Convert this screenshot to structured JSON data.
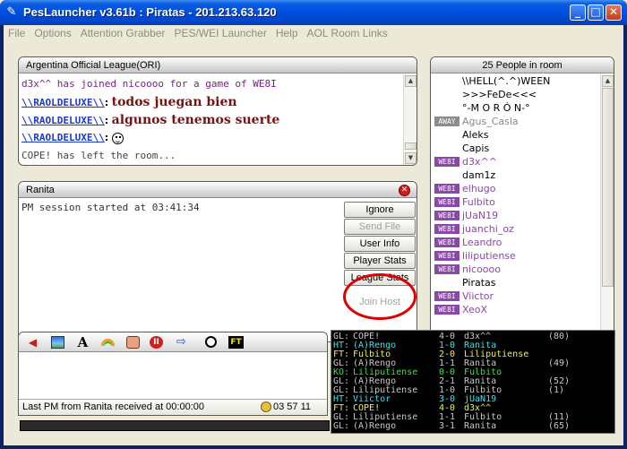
{
  "window": {
    "title": "PesLauncher v3.61b : Piratas - 201.213.63.120",
    "minimize": "_",
    "maximize": "□",
    "close": "✕"
  },
  "menu": [
    "File",
    "Options",
    "Attention Grabber",
    "PES/WEI Launcher",
    "Help",
    "AOL Room Links"
  ],
  "chat": {
    "title": "Argentina Official League(ORI)",
    "lines": [
      {
        "kind": "sys",
        "text": "d3x^^ has joined nicoooo for a game of WE8I"
      },
      {
        "kind": "msg",
        "nick": "\\\\RAOLDELUXE\\\\",
        "text": "todos juegan bien"
      },
      {
        "kind": "msg",
        "nick": "\\\\RAOLDELUXE\\\\",
        "text": "algunos tenemos suerte"
      },
      {
        "kind": "msg",
        "nick": "\\\\RAOLDELUXE\\\\",
        "text": ""
      },
      {
        "kind": "sys-gray",
        "text": "COPE! has left the room..."
      }
    ],
    "colon": ":"
  },
  "pm": {
    "title": "Ranita",
    "message": "PM session started at 03:41:34",
    "buttons": [
      {
        "label": "Ignore",
        "enabled": true
      },
      {
        "label": "Send File",
        "enabled": false
      },
      {
        "label": "User Info",
        "enabled": true
      },
      {
        "label": "Player Stats",
        "enabled": true
      },
      {
        "label": "League Stats",
        "enabled": true
      },
      {
        "label": "Join Host",
        "enabled": false
      }
    ]
  },
  "users": {
    "title": "25 People in room",
    "list": [
      {
        "badge": "",
        "name": "\\\\HELL(^.^)WEEN",
        "style": "normal"
      },
      {
        "badge": "",
        "name": ">>>FeDe<<<",
        "style": "normal"
      },
      {
        "badge": "",
        "name": "°-M O R Ó N-°",
        "style": "normal"
      },
      {
        "badge": "AWAY",
        "name": "Agus_Casla",
        "style": "gray"
      },
      {
        "badge": "",
        "name": "Aleks",
        "style": "normal"
      },
      {
        "badge": "",
        "name": "Capis",
        "style": "normal"
      },
      {
        "badge": "WE8I",
        "name": "d3x^^",
        "style": "we"
      },
      {
        "badge": "",
        "name": "dam1z",
        "style": "normal"
      },
      {
        "badge": "WE8I",
        "name": "elhugo",
        "style": "we"
      },
      {
        "badge": "WE8I",
        "name": "Fulbito",
        "style": "we"
      },
      {
        "badge": "WE8I",
        "name": "jUaN19",
        "style": "we"
      },
      {
        "badge": "WE8I",
        "name": "juanchi_oz",
        "style": "we"
      },
      {
        "badge": "WE8I",
        "name": "Leandro",
        "style": "we"
      },
      {
        "badge": "WE8I",
        "name": "liliputiense",
        "style": "we"
      },
      {
        "badge": "WE8I",
        "name": "nicoooo",
        "style": "we"
      },
      {
        "badge": "",
        "name": "Piratas",
        "style": "normal"
      },
      {
        "badge": "WE8I",
        "name": "Viictor",
        "style": "we"
      },
      {
        "badge": "WE8I",
        "name": "XeoX",
        "style": "we"
      }
    ]
  },
  "composer": {
    "icons": [
      "megaphone-icon",
      "picture-icon",
      "font-icon",
      "rainbow-icon",
      "face-icon",
      "stop-icon",
      "exit-icon",
      "ball-icon",
      "ft-icon"
    ],
    "ft_label": "FT",
    "font_label": "A",
    "status": "Last PM from Ranita received at 00:00:00",
    "time": "03 57 11"
  },
  "scores": [
    {
      "tag": "GL:",
      "team": "COPE!",
      "score": "4-0",
      "opp": "d3x^^",
      "extra": "(80)",
      "color": "gray"
    },
    {
      "tag": "HT:",
      "team": "(A)Rengo",
      "score": "1-0",
      "opp": "Ranita",
      "extra": "",
      "color": "cyan"
    },
    {
      "tag": "FT:",
      "team": "Fulbito",
      "score": "2-0",
      "opp": "Liliputiense",
      "extra": "",
      "color": "yellow"
    },
    {
      "tag": "GL:",
      "team": "(A)Rengo",
      "score": "1-1",
      "opp": "Ranita",
      "extra": "(49)",
      "color": "gray"
    },
    {
      "tag": "KO:",
      "team": "Liliputiense",
      "score": "0-0",
      "opp": "Fulbito",
      "extra": "",
      "color": "green"
    },
    {
      "tag": "GL:",
      "team": "(A)Rengo",
      "score": "2-1",
      "opp": "Ranita",
      "extra": "(52)",
      "color": "gray"
    },
    {
      "tag": "GL:",
      "team": "Liliputiense",
      "score": "1-0",
      "opp": "Fulbito",
      "extra": "(1)",
      "color": "gray"
    },
    {
      "tag": "HT:",
      "team": "Viictor",
      "score": "3-0",
      "opp": "jUaN19",
      "extra": "",
      "color": "cyan"
    },
    {
      "tag": "FT:",
      "team": "COPE!",
      "score": "4-0",
      "opp": "d3x^^",
      "extra": "",
      "color": "yellow"
    },
    {
      "tag": "GL:",
      "team": "Liliputiense",
      "score": "1-1",
      "opp": "Fulbito",
      "extra": "(11)",
      "color": "gray"
    },
    {
      "tag": "GL:",
      "team": "(A)Rengo",
      "score": "3-1",
      "opp": "Ranita",
      "extra": "(65)",
      "color": "gray"
    }
  ],
  "colors": {
    "we_badge": "#8A48A8",
    "away_badge": "#8C8C8C",
    "nick": "#1A3ACC",
    "bigmsg": "#7A1010",
    "highlight": "#E00000"
  }
}
